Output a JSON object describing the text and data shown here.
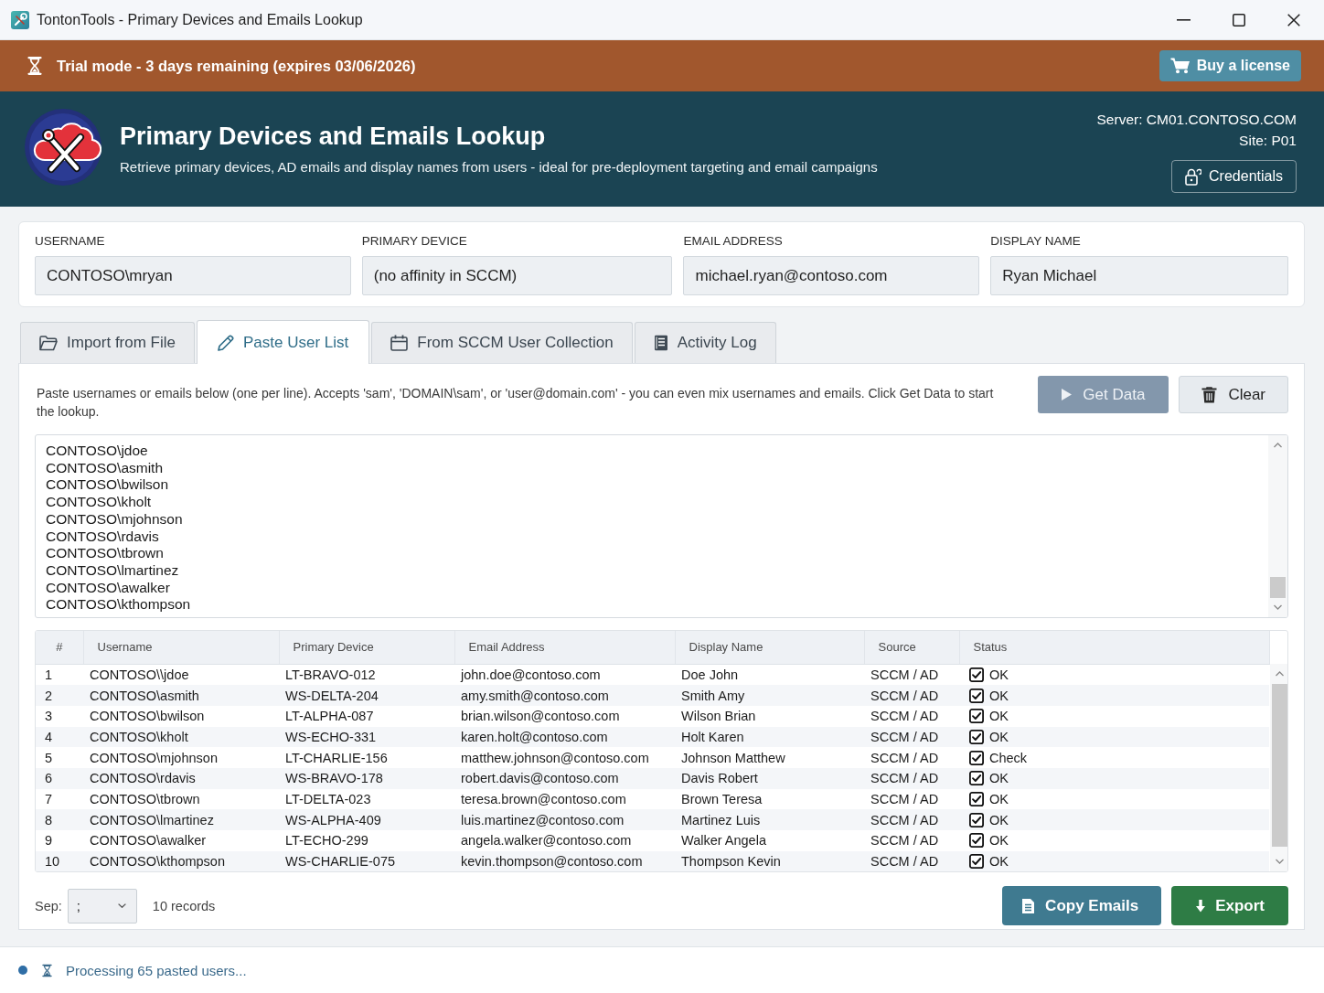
{
  "window": {
    "title": "TontonTools - Primary Devices and Emails Lookup"
  },
  "trial_banner": {
    "text": "Trial mode - 3 days remaining (expires 03/06/2026)",
    "button": "Buy a license"
  },
  "header": {
    "title": "Primary Devices and Emails Lookup",
    "subtitle": "Retrieve primary devices, AD emails and display names from users - ideal for pre-deployment targeting and email campaigns",
    "server": "Server: CM01.CONTOSO.COM",
    "site": "Site: P01",
    "credentials_button": "Credentials"
  },
  "lookup_fields": [
    {
      "label": "USERNAME",
      "value": "CONTOSO\\mryan"
    },
    {
      "label": "PRIMARY DEVICE",
      "value": "(no affinity in SCCM)"
    },
    {
      "label": "EMAIL ADDRESS",
      "value": "michael.ryan@contoso.com"
    },
    {
      "label": "DISPLAY NAME",
      "value": "Ryan Michael"
    }
  ],
  "tabs": [
    {
      "label": "Import from File",
      "selected": false
    },
    {
      "label": "Paste User List",
      "selected": true
    },
    {
      "label": "From SCCM User Collection",
      "selected": false
    },
    {
      "label": "Activity Log",
      "selected": false
    }
  ],
  "paste_panel": {
    "instructions": "Paste usernames or emails below (one per line). Accepts 'sam', 'DOMAIN\\sam', or 'user@domain.com' - you can even mix usernames and emails. Click Get Data to start the lookup.",
    "buttons": [
      {
        "label": "Get Data",
        "kind": "run",
        "disabled": true
      },
      {
        "label": "Clear",
        "kind": "clear",
        "disabled": false
      }
    ],
    "pasted_lines": [
      "CONTOSO\\jdoe",
      "CONTOSO\\asmith",
      "CONTOSO\\bwilson",
      "CONTOSO\\kholt",
      "CONTOSO\\mjohnson",
      "CONTOSO\\rdavis",
      "CONTOSO\\tbrown",
      "CONTOSO\\lmartinez",
      "CONTOSO\\awalker",
      "CONTOSO\\kthompson"
    ]
  },
  "table": {
    "columns": [
      "#",
      "Username",
      "Primary Device",
      "Email Address",
      "Display Name",
      "Source",
      "Status"
    ],
    "rows": [
      {
        "number": "1",
        "username": "CONTOSO\\\\jdoe",
        "primary_device": "LT-BRAVO-012",
        "email": "john.doe@contoso.com",
        "display_name": "Doe John",
        "source": "SCCM / AD",
        "status": "OK"
      },
      {
        "number": "2",
        "username": "CONTOSO\\asmith",
        "primary_device": "WS-DELTA-204",
        "email": "amy.smith@contoso.com",
        "display_name": "Smith Amy",
        "source": "SCCM / AD",
        "status": "OK"
      },
      {
        "number": "3",
        "username": "CONTOSO\\bwilson",
        "primary_device": "LT-ALPHA-087",
        "email": "brian.wilson@contoso.com",
        "display_name": "Wilson Brian",
        "source": "SCCM / AD",
        "status": "OK"
      },
      {
        "number": "4",
        "username": "CONTOSO\\kholt",
        "primary_device": "WS-ECHO-331",
        "email": "karen.holt@contoso.com",
        "display_name": "Holt Karen",
        "source": "SCCM / AD",
        "status": "OK"
      },
      {
        "number": "5",
        "username": "CONTOSO\\mjohnson",
        "primary_device": "LT-CHARLIE-156",
        "email": "matthew.johnson@contoso.com",
        "display_name": "Johnson Matthew",
        "source": "SCCM / AD",
        "status": "Check"
      },
      {
        "number": "6",
        "username": "CONTOSO\\rdavis",
        "primary_device": "WS-BRAVO-178",
        "email": "robert.davis@contoso.com",
        "display_name": "Davis Robert",
        "source": "SCCM / AD",
        "status": "OK"
      },
      {
        "number": "7",
        "username": "CONTOSO\\tbrown",
        "primary_device": "LT-DELTA-023",
        "email": "teresa.brown@contoso.com",
        "display_name": "Brown Teresa",
        "source": "SCCM / AD",
        "status": "OK"
      },
      {
        "number": "8",
        "username": "CONTOSO\\lmartinez",
        "primary_device": "WS-ALPHA-409",
        "email": "luis.martinez@contoso.com",
        "display_name": "Martinez Luis",
        "source": "SCCM / AD",
        "status": "OK"
      },
      {
        "number": "9",
        "username": "CONTOSO\\awalker",
        "primary_device": "LT-ECHO-299",
        "email": "angela.walker@contoso.com",
        "display_name": "Walker Angela",
        "source": "SCCM / AD",
        "status": "OK"
      },
      {
        "number": "10",
        "username": "CONTOSO\\kthompson",
        "primary_device": "WS-CHARLIE-075",
        "email": "kevin.thompson@contoso.com",
        "display_name": "Thompson Kevin",
        "source": "SCCM / AD",
        "status": "OK"
      }
    ]
  },
  "footer": {
    "separator_label": "Sep:",
    "separator_value": ";",
    "record_count": "10 records",
    "buttons": [
      {
        "label": "Copy Emails",
        "kind": "copy"
      },
      {
        "label": "Export",
        "kind": "export"
      }
    ]
  },
  "status_bar": {
    "text": "Processing 65 pasted users..."
  }
}
